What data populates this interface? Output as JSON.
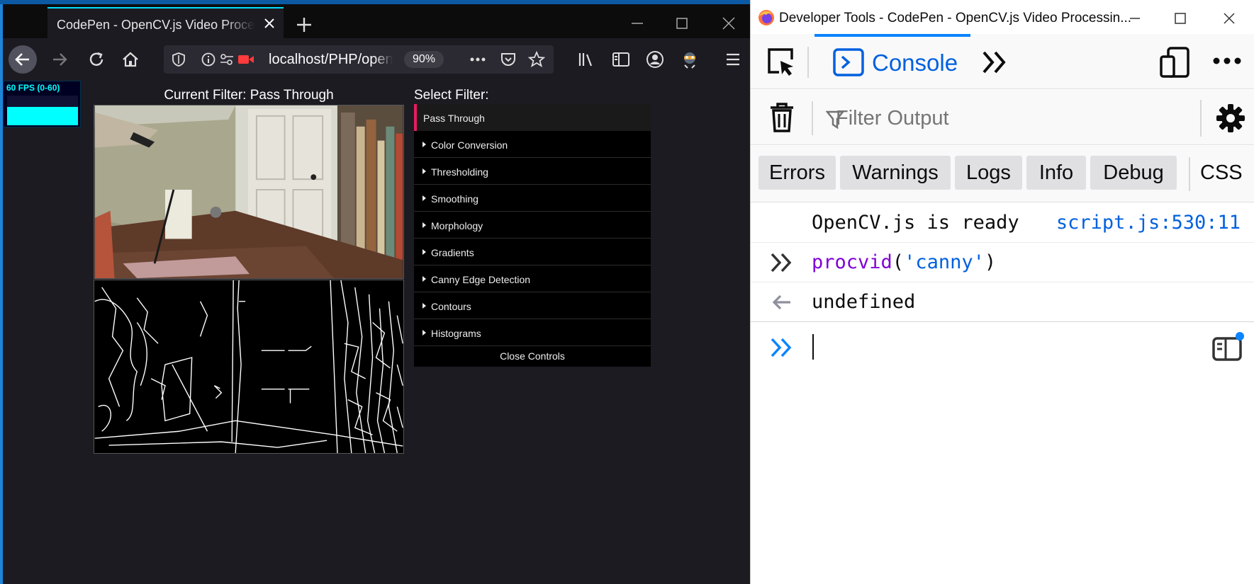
{
  "browser": {
    "tab_title": "CodePen - OpenCV.js Video Processing",
    "url": "localhost/PHP/opencv",
    "zoom": "90%"
  },
  "page": {
    "fps_label": "60 FPS (0-60)",
    "current_filter": "Current Filter: Pass Through",
    "select_filter_label": "Select Filter:",
    "active_filter": "Pass Through",
    "filters": [
      "Color Conversion",
      "Thresholding",
      "Smoothing",
      "Morphology",
      "Gradients",
      "Canny Edge Detection",
      "Contours",
      "Histograms"
    ],
    "close_controls": "Close Controls"
  },
  "devtools": {
    "title": "Developer Tools - CodePen - OpenCV.js Video Processin...",
    "active_tab": "Console",
    "filter_placeholder": "Filter Output",
    "levels": [
      "Errors",
      "Warnings",
      "Logs",
      "Info",
      "Debug"
    ],
    "css_label": "CSS",
    "log": {
      "message": "OpenCV.js is ready",
      "source": "script.js:530:11",
      "command_fn": "procvid",
      "command_paren_open": "(",
      "command_arg": "'canny'",
      "command_paren_close": ")",
      "result": "undefined"
    }
  },
  "colors": {
    "accent": "#0a84ff",
    "gui_active_border": "#e61d5f",
    "fps_cyan": "#00ffff"
  }
}
